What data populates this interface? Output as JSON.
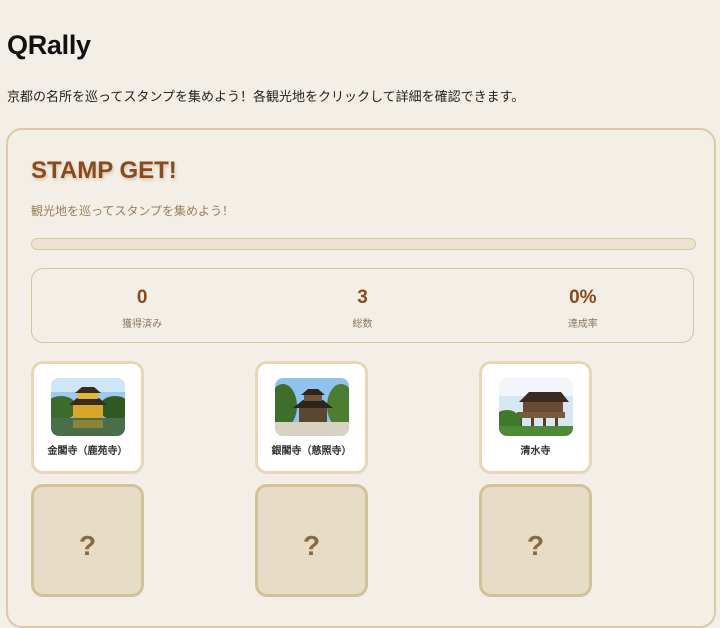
{
  "app": {
    "title": "QRally",
    "description": "京都の名所を巡ってスタンプを集めよう！各観光地をクリックして詳細を確認できます。"
  },
  "card": {
    "title": "STAMP GET!",
    "subtitle": "観光地を巡ってスタンプを集めよう！",
    "progress_fraction": 0
  },
  "stats": [
    {
      "value": "0",
      "label": "獲得済み"
    },
    {
      "value": "3",
      "label": "総数"
    },
    {
      "value": "0%",
      "label": "達成率"
    }
  ],
  "spots": [
    {
      "name": "金閣寺（鹿苑寺）",
      "photo": "kinkakuji-photo"
    },
    {
      "name": "銀閣寺（慈照寺）",
      "photo": "ginkakuji-photo"
    },
    {
      "name": "清水寺",
      "photo": "kiyomizudera-photo"
    }
  ],
  "unknown_tiles": [
    "?",
    "?",
    "?"
  ],
  "colors": {
    "accent": "#8a4a1c",
    "background": "#f4efe6",
    "card_border": "#dcc9a6"
  }
}
